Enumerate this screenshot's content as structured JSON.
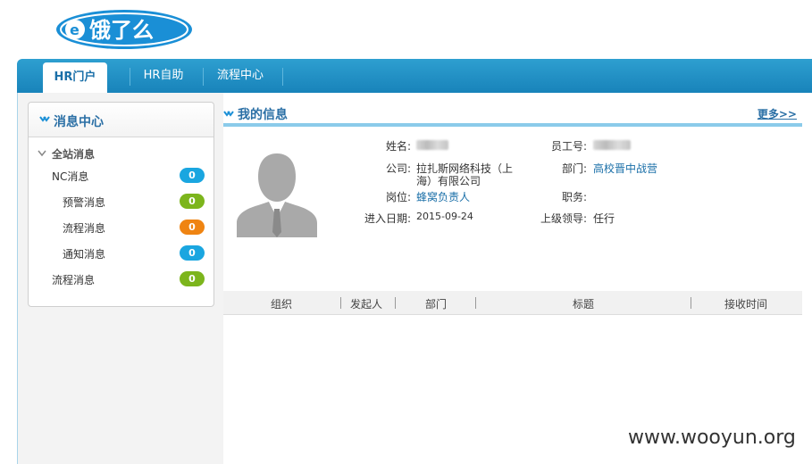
{
  "logo": {
    "text": "饿了么"
  },
  "nav": {
    "tabs": [
      {
        "label": "HR门户",
        "active": true
      },
      {
        "label": "HR自助",
        "active": false
      },
      {
        "label": "流程中心",
        "active": false
      }
    ]
  },
  "messages": {
    "title": "消息中心",
    "group_label": "全站消息",
    "items": [
      {
        "label": "NC消息",
        "count": "0",
        "color": "#1aa6e0"
      },
      {
        "label": "预警消息",
        "count": "0",
        "color": "#7cb51c"
      },
      {
        "label": "流程消息",
        "count": "0",
        "color": "#ef8412"
      },
      {
        "label": "通知消息",
        "count": "0",
        "color": "#1aa6e0"
      },
      {
        "label": "流程消息",
        "count": "0",
        "color": "#7cb51c"
      }
    ]
  },
  "info": {
    "title": "我的信息",
    "more": "更多>>",
    "fields": {
      "name_label": "姓名:",
      "name_value": "",
      "empno_label": "员工号:",
      "empno_value": "",
      "company_label": "公司:",
      "company_value_line1": "拉扎斯网络科技（上",
      "company_value_line2": "海）有限公司",
      "dept_label": "部门:",
      "dept_value": "高校晋中战营",
      "post_label": "岗位:",
      "post_value": "蜂窝负责人",
      "duty_label": "职务:",
      "duty_value": "",
      "join_label": "进入日期:",
      "join_value": "2015-09-24",
      "leader_label": "上级领导:",
      "leader_value": "任行"
    }
  },
  "table": {
    "columns": [
      "组织",
      "发起人",
      "部门",
      "标题",
      "接收时间"
    ]
  },
  "watermark": "www.wooyun.org"
}
